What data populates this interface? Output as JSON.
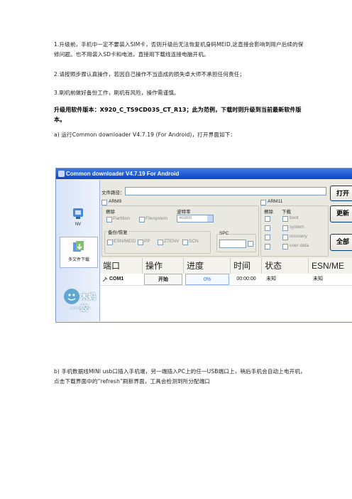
{
  "doc": {
    "para1": "1.升级前，手机中一定不要装入SIM卡，否则升级后无法恢复机身码MEID,这直接会影响到用户后续的保修问题。也不用装入SD卡和电池，直接用下载线连接电脑开机。",
    "para2": "2.请按照步骤认真操作，若因自己操作不当造成的损失卓大师不承担任何责任；",
    "para3": "3.刷机前做好备份工作，刷机有风险，操作需谨慎。",
    "para4": "升级用软件版本：X920_C_TS9CD03S_CT_R13；此为范例，下载时则升级到当前最新软件版本。",
    "para5": "a) 运行Common downloader V4.7.19 (For Android)，打开界面如下：",
    "para6": "b) 手机数据线MINI usb口插入手机端，另一端插入PC上的任一USB端口上，稍后手机会自动上电开机，点击下载界面中的“refresh”刷新界面，工具会检测到所分配端口"
  },
  "app": {
    "title": "Common downloader V4.7.19 For Android",
    "sidebar": {
      "nv_label": "NV",
      "multi_label": "多文件下载"
    },
    "file_path_label": "文件路径：",
    "buttons": {
      "open": "打开",
      "update": "更新",
      "all": "全部"
    },
    "arm9": {
      "label": "ARM9",
      "erase_label": "擦除",
      "partition": "Partition",
      "filesystem": "Filesystem",
      "baud_label": "波特率",
      "baud_value": "460800",
      "backup_label": "备份/恢复",
      "backup_options": [
        "ESN/MEID",
        "PP",
        "ZTENV",
        "SCN"
      ],
      "spc_label": "SPC"
    },
    "arm11": {
      "label": "ARM11",
      "erase_label": "擦除",
      "download_label": "下载",
      "items": [
        "boot",
        "system",
        "recovery",
        "user data"
      ]
    },
    "table": {
      "headers": [
        "端口",
        "操作",
        "进度",
        "时间",
        "状态",
        "ESN/ME"
      ],
      "row": {
        "port": "COM1",
        "action": "开始",
        "progress": "0%",
        "time": "00:00:00",
        "status": "未知",
        "esn": "未知"
      }
    },
    "watermark": {
      "text": "木蚂蚁",
      "url": "mumayi.com"
    }
  }
}
